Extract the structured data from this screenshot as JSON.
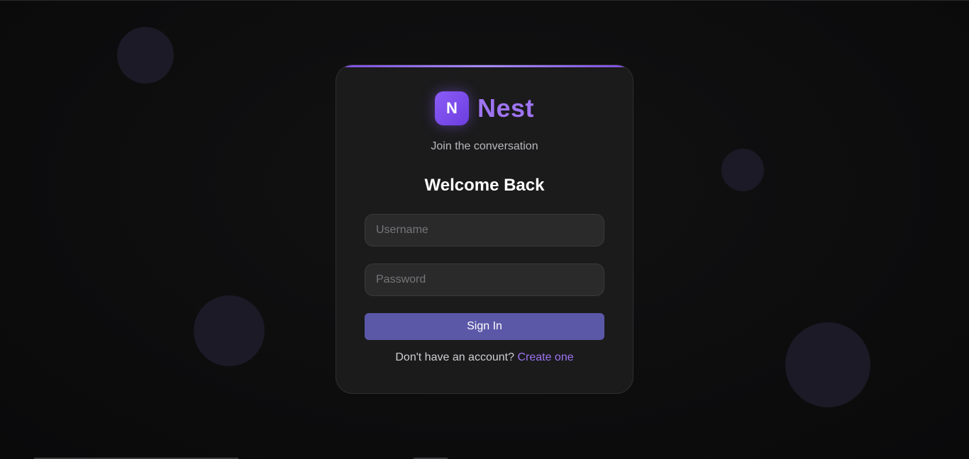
{
  "brand": {
    "logo_letter": "N",
    "name": "Nest",
    "tagline": "Join the conversation",
    "accent_color": "#9e74f2"
  },
  "login": {
    "heading": "Welcome Back",
    "username_placeholder": "Username",
    "username_value": "",
    "password_placeholder": "Password",
    "password_value": "",
    "submit_label": "Sign In",
    "button_color": "#5c58a8"
  },
  "footer": {
    "prompt": "Don't have an account?",
    "link_label": "Create one"
  },
  "colors": {
    "background": "#0d0d0e",
    "card": "#1b1b1c",
    "bubble": "#1c1a26"
  }
}
